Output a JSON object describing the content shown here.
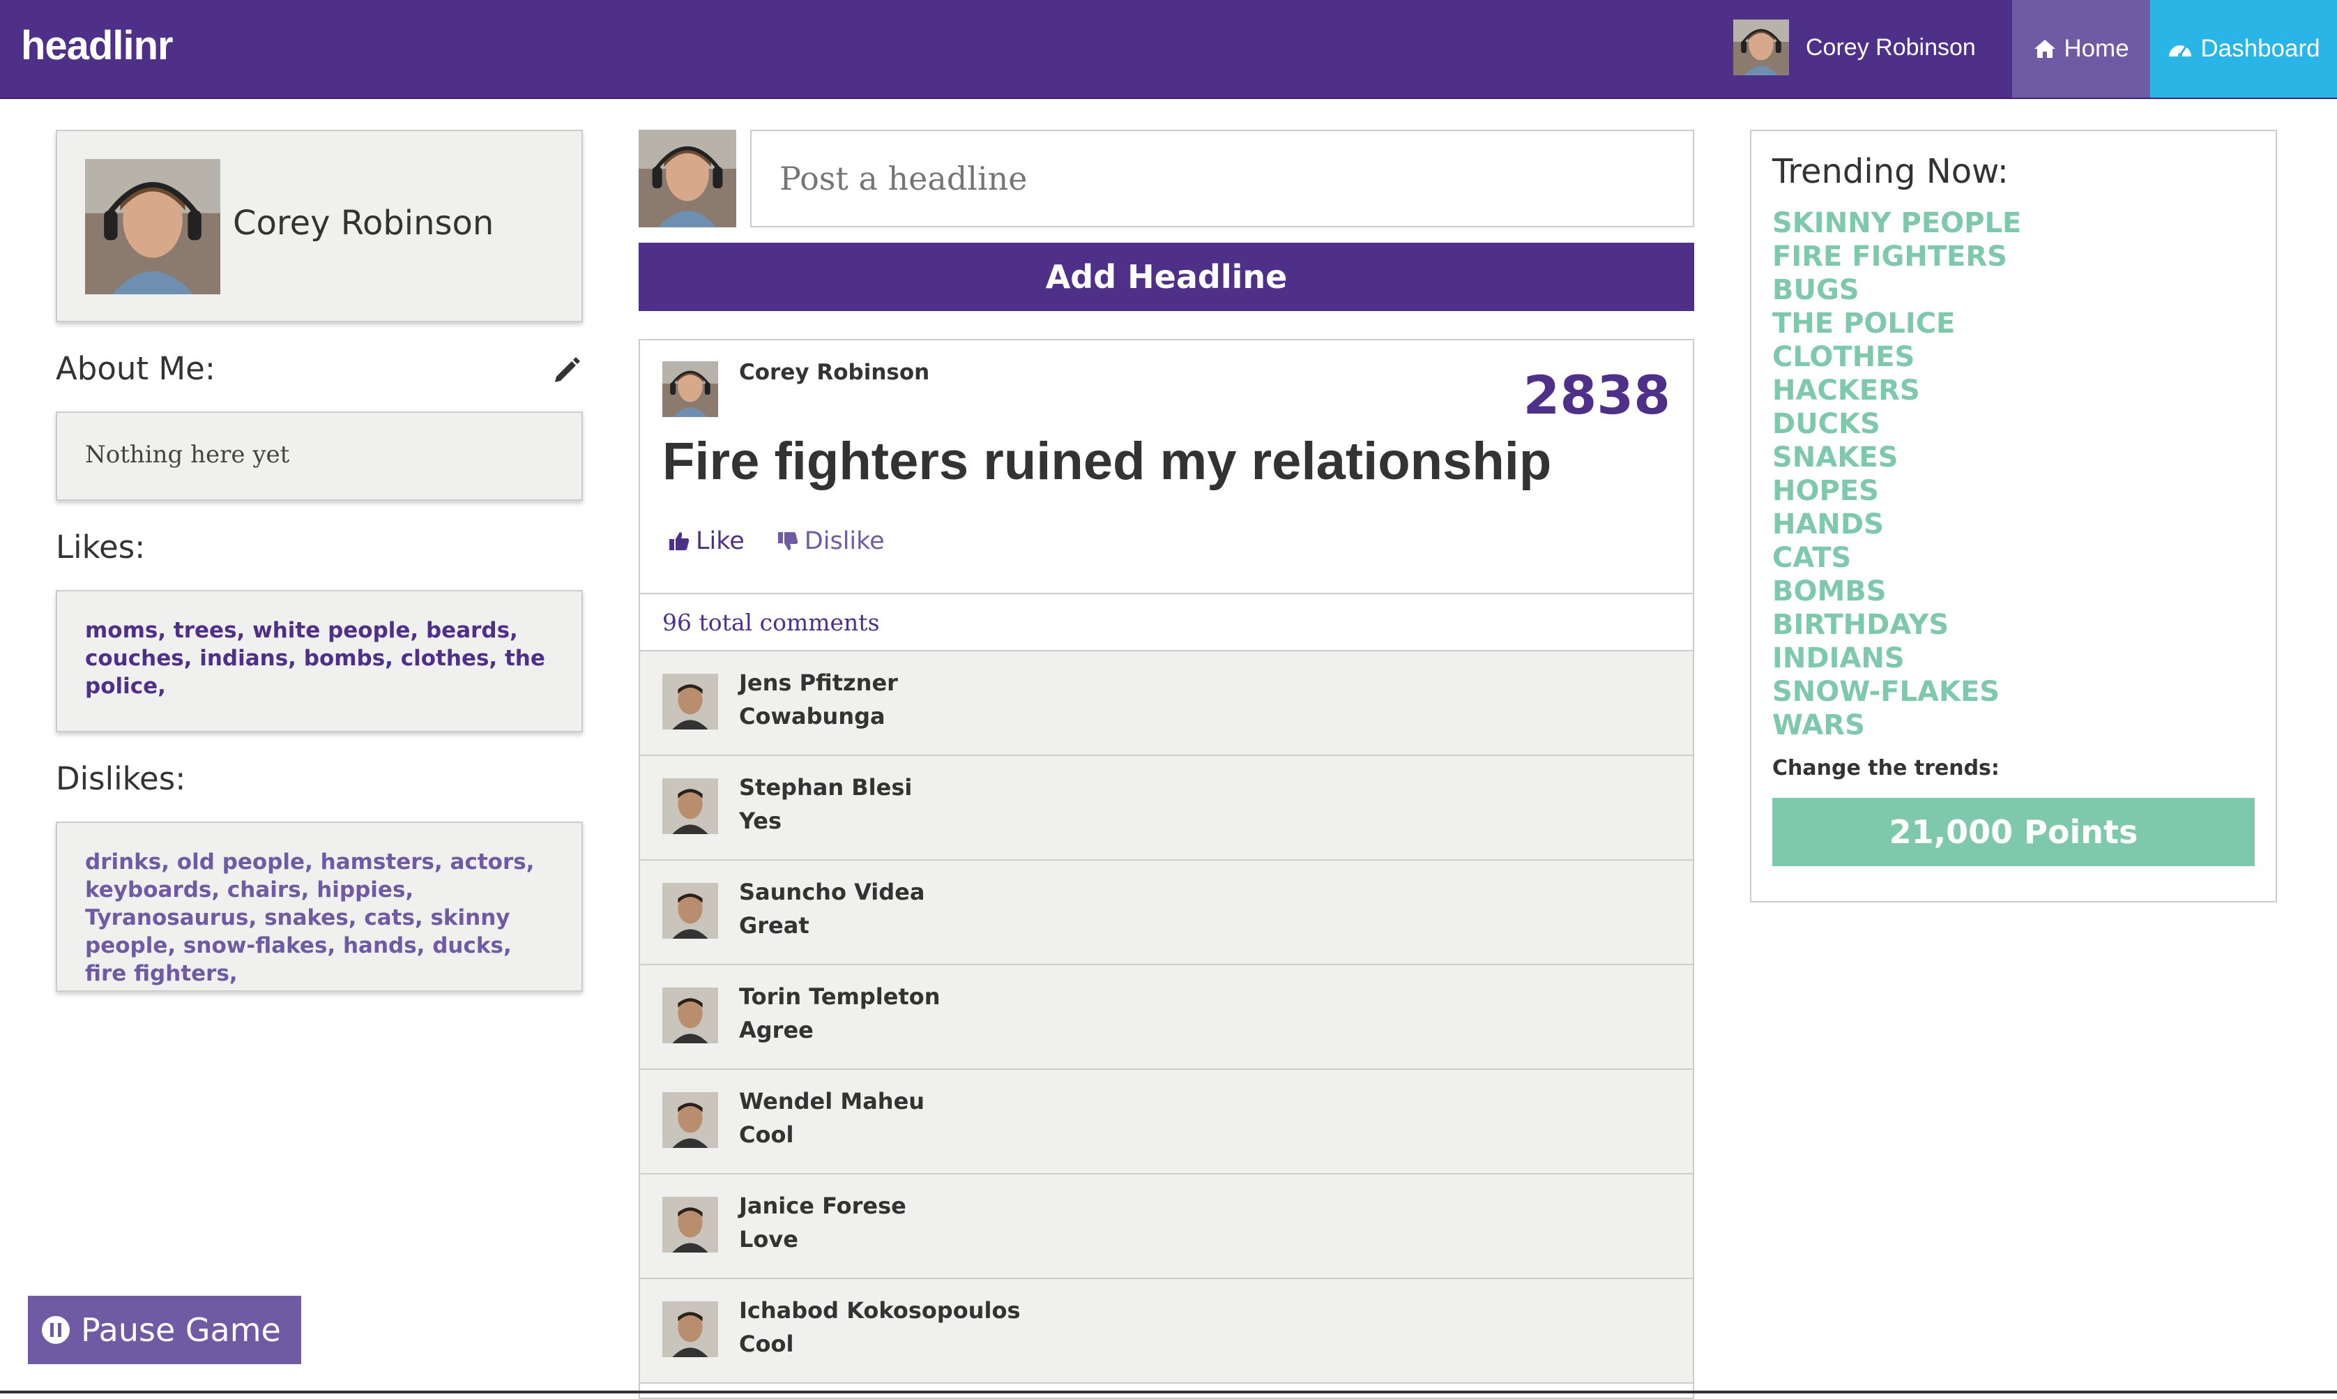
{
  "app": {
    "brand": "headlinr"
  },
  "nav": {
    "user_name": "Corey Robinson",
    "home": "Home",
    "dashboard": "Dashboard"
  },
  "profile": {
    "name": "Corey Robinson",
    "about_title": "About Me:",
    "about_text": "Nothing here yet",
    "likes_title": "Likes:",
    "likes_text": "moms, trees, white people, beards, couches, indians, bombs, clothes, the police,",
    "dislikes_title": "Dislikes:",
    "dislikes_text": "drinks, old people, hamsters, actors, keyboards, chairs, hippies, Tyranosaurus, snakes, cats, skinny people, snow-flakes, hands, ducks, fire fighters,"
  },
  "composer": {
    "placeholder": "Post a headline",
    "add_button": "Add Headline"
  },
  "post": {
    "author": "Corey Robinson",
    "score": "2838",
    "headline": "Fire fighters ruined my relationship",
    "like": "Like",
    "dislike": "Dislike",
    "comments_count": "96 total comments",
    "comments": [
      {
        "name": "Jens Pfitzner",
        "text": "Cowabunga"
      },
      {
        "name": "Stephan Blesi",
        "text": "Yes"
      },
      {
        "name": "Sauncho Videa",
        "text": "Great"
      },
      {
        "name": "Torin Templeton",
        "text": "Agree"
      },
      {
        "name": "Wendel Maheu",
        "text": "Cool"
      },
      {
        "name": "Janice Forese",
        "text": "Love"
      },
      {
        "name": "Ichabod Kokosopoulos",
        "text": "Cool"
      }
    ]
  },
  "trending": {
    "title": "Trending Now:",
    "items": [
      "SKINNY PEOPLE",
      "FIRE FIGHTERS",
      "BUGS",
      "THE POLICE",
      "CLOTHES",
      "HACKERS",
      "DUCKS",
      "SNAKES",
      "HOPES",
      "HANDS",
      "CATS",
      "BOMBS",
      "BIRTHDAYS",
      "INDIANS",
      "SNOW-FLAKES",
      "WARS"
    ],
    "change_label": "Change the trends:",
    "points_button": "21,000 Points"
  },
  "game": {
    "pause_button": "Pause Game"
  },
  "colors": {
    "brand_purple": "#4e3088",
    "light_purple": "#6f5aa4",
    "accent_blue": "#2bb5e6",
    "trend_green": "#7ec8ab"
  }
}
